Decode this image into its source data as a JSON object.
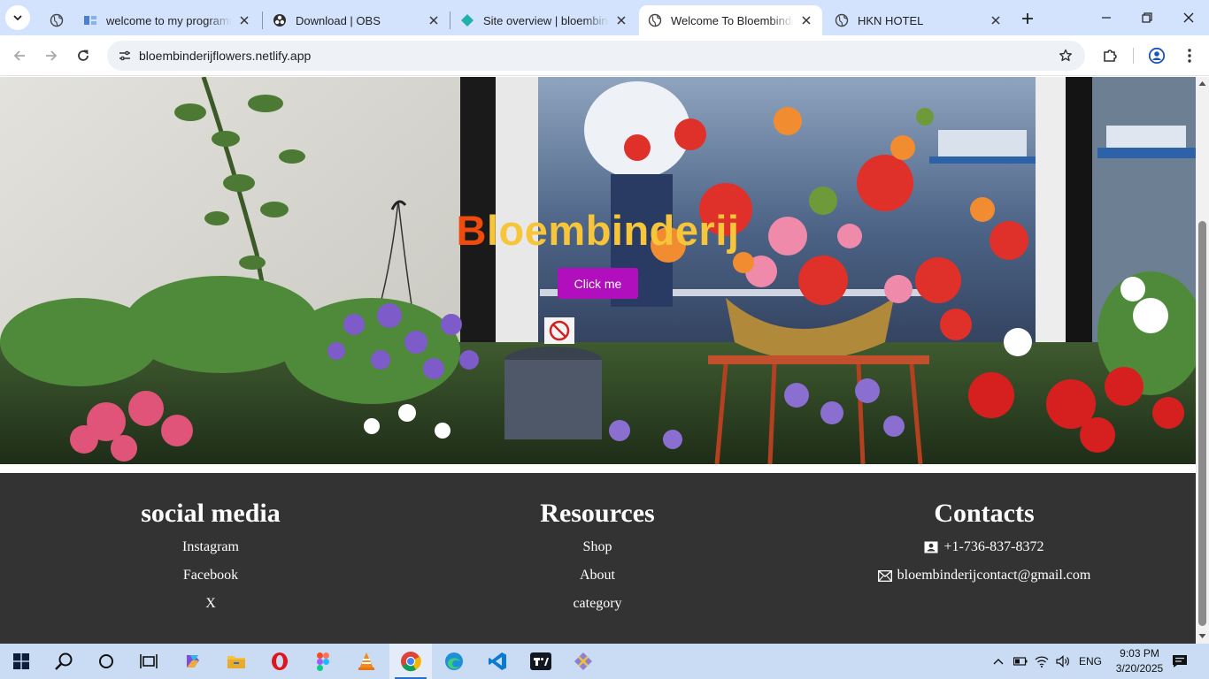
{
  "browser": {
    "tabs": [
      {
        "title": "welcome to my programm",
        "active": false,
        "favicon": "document-icon"
      },
      {
        "title": "Download | OBS",
        "active": false,
        "favicon": "obs-icon"
      },
      {
        "title": "Site overview | bloembinde",
        "active": false,
        "favicon": "netlify-icon"
      },
      {
        "title": "Welcome To Bloembinderij",
        "active": true,
        "favicon": "globe-icon"
      },
      {
        "title": "HKN HOTEL",
        "active": false,
        "favicon": "globe-icon"
      }
    ],
    "url": "bloembinderijflowers.netlify.app"
  },
  "hero": {
    "title_first": "B",
    "title_rest": "loembinderij",
    "button_label": "Click me",
    "title_color": "#f7c53a",
    "first_letter_color": "#f04a0c",
    "button_color": "#b10fbd"
  },
  "footer": {
    "social": {
      "heading": "social media",
      "items": [
        "Instagram",
        "Facebook",
        "X"
      ]
    },
    "resources": {
      "heading": "Resources",
      "items": [
        "Shop",
        "About",
        "category"
      ]
    },
    "contacts": {
      "heading": "Contacts",
      "phone": "+1-736-837-8372",
      "email": "bloembinderijcontact@gmail.com"
    },
    "background": "#333333"
  },
  "taskbar": {
    "language": "ENG",
    "time": "9:03 PM",
    "date": "3/20/2025"
  }
}
